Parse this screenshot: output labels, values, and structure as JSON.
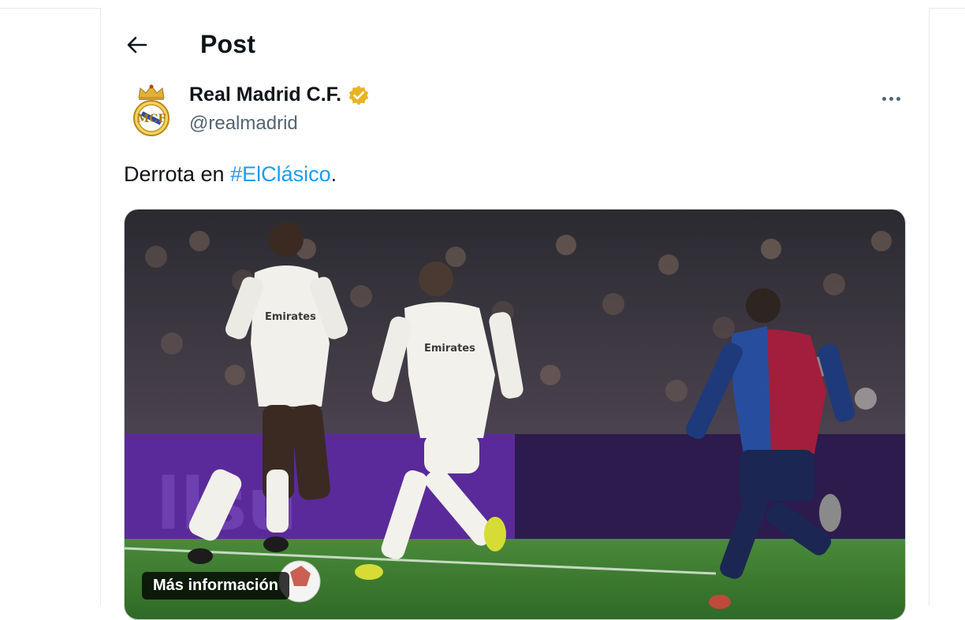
{
  "header": {
    "title": "Post",
    "back_icon": "arrow-left-icon"
  },
  "author": {
    "name": "Real Madrid C.F.",
    "handle": "@realmadrid",
    "verified_color": "#e8b423",
    "avatar_icon": "real-madrid-crest"
  },
  "tweet": {
    "text_before": "Derrota en ",
    "hashtag": "#ElClásico",
    "text_after": "."
  },
  "media": {
    "alt_button": "Más información",
    "description_icon": "football-match-photo"
  },
  "colors": {
    "link": "#1d9bf0",
    "muted": "#536471"
  }
}
